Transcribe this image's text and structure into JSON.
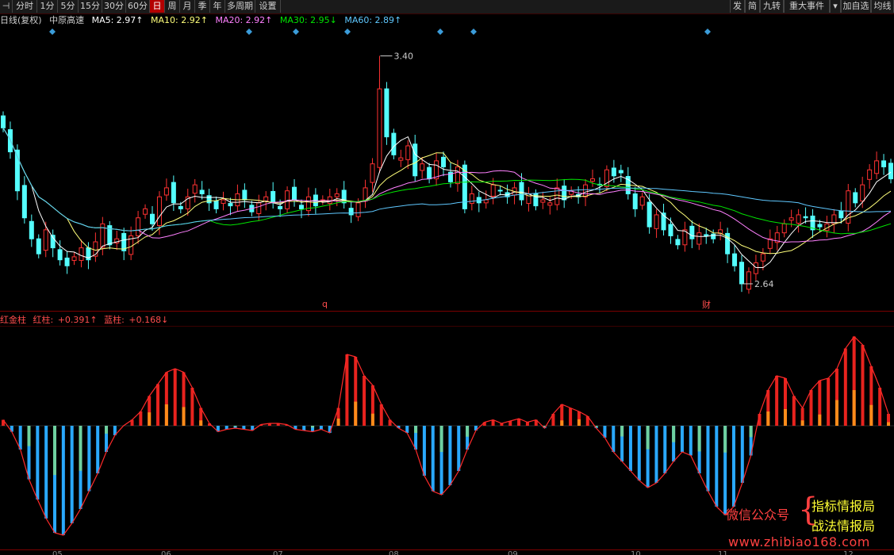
{
  "toolbar": {
    "left_items": [
      {
        "label": "⊣",
        "active": false
      },
      {
        "label": "分时",
        "active": false
      },
      {
        "label": "1分",
        "active": false
      },
      {
        "label": "5分",
        "active": false
      },
      {
        "label": "15分",
        "active": false
      },
      {
        "label": "30分",
        "active": false
      },
      {
        "label": "60分",
        "active": false
      },
      {
        "label": "日",
        "active": true
      },
      {
        "label": "周",
        "active": false
      },
      {
        "label": "月",
        "active": false
      },
      {
        "label": "季",
        "active": false
      },
      {
        "label": "年",
        "active": false
      },
      {
        "label": "多周期",
        "active": false
      },
      {
        "label": "设置",
        "active": false
      }
    ],
    "right_items": [
      {
        "label": "发"
      },
      {
        "label": "简"
      },
      {
        "label": "九转"
      },
      {
        "label": "重大事件"
      },
      {
        "label": "▾"
      },
      {
        "label": "加自选"
      },
      {
        "label": "均线"
      }
    ]
  },
  "legend_main": {
    "period": "日线(复权)",
    "name": "中原高速",
    "ma5": "MA5: 2.97↑",
    "ma10": "MA10: 2.92↑",
    "ma20": "MA20: 2.92↑",
    "ma30": "MA30: 2.95↓",
    "ma60": "MA60: 2.89↑"
  },
  "legend_indicator": {
    "name": "红金柱",
    "red_label": "红柱:",
    "red_value": "+0.391↑",
    "blue_label": "蓝柱:",
    "blue_value": "+0.168↓"
  },
  "annotations": {
    "high": "3.40",
    "low": "2.64",
    "marker_q": "q",
    "marker_cai": "财"
  },
  "watermark": {
    "wechat_label": "微信公众号",
    "brand1": "指标情报局",
    "brand2": "战法情报局",
    "url": "www.zhibiao168.com"
  },
  "axis_dates": [
    "05",
    "06",
    "07",
    "08",
    "09",
    "10",
    "11",
    "12"
  ],
  "colors": {
    "up": "#ff3232",
    "down": "#54ffff",
    "ma5": "#ffffff",
    "ma10": "#ffff7a",
    "ma20": "#ff80ff",
    "ma30": "#00e600",
    "ma60": "#5fc8ff",
    "red_bar": "#e8231e",
    "gold_bar": "#ff8c1a",
    "blue_bar": "#2aa9ff",
    "green_bar": "#6fd1a0"
  },
  "chart_data": [
    {
      "type": "candlestick",
      "title": "中原高速 日线(复权)",
      "close": [
        3.16,
        3.08,
        2.95,
        2.86,
        2.79,
        2.74,
        2.82,
        2.76,
        2.72,
        2.7,
        2.73,
        2.76,
        2.72,
        2.78,
        2.84,
        2.77,
        2.79,
        2.75,
        2.8,
        2.86,
        2.89,
        2.84,
        2.93,
        2.96,
        2.91,
        2.89,
        2.93,
        2.97,
        2.94,
        2.91,
        2.89,
        2.92,
        2.9,
        2.94,
        2.92,
        2.88,
        2.91,
        2.93,
        2.91,
        2.89,
        2.95,
        2.92,
        2.89,
        2.93,
        2.9,
        2.92,
        2.93,
        2.94,
        2.91,
        2.87,
        2.91,
        2.96,
        3.04,
        3.29,
        3.13,
        3.07,
        3.06,
        3.1,
        3.0,
        3.04,
        2.99,
        3.05,
        3.03,
        2.98,
        3.03,
        2.89,
        2.94,
        2.91,
        2.92,
        2.97,
        2.95,
        2.93,
        2.96,
        2.92,
        2.94,
        2.9,
        2.92,
        2.91,
        2.96,
        2.92,
        2.95,
        2.93,
        2.97,
        2.99,
        2.97,
        3.02,
        3.0,
        3.01,
        2.94,
        2.89,
        2.93,
        2.83,
        2.87,
        2.82,
        2.8,
        2.77,
        2.82,
        2.79,
        2.81,
        2.8,
        2.79,
        2.82,
        2.74,
        2.7,
        2.64,
        2.68,
        2.71,
        2.74,
        2.79,
        2.81,
        2.84,
        2.86,
        2.87,
        2.86,
        2.82,
        2.83,
        2.84,
        2.87,
        2.86,
        2.95,
        2.91,
        2.97,
        3.02,
        3.05,
        3.03,
        2.99
      ],
      "high_label": "3.40",
      "low_label": "2.64",
      "series": [
        {
          "name": "MA5",
          "value": 2.97
        },
        {
          "name": "MA10",
          "value": 2.92
        },
        {
          "name": "MA20",
          "value": 2.92
        },
        {
          "name": "MA30",
          "value": 2.95
        },
        {
          "name": "MA60",
          "value": 2.89
        }
      ]
    },
    {
      "type": "bar",
      "title": "红金柱",
      "values": [
        0.05,
        -0.05,
        -0.2,
        -0.45,
        -0.62,
        -0.78,
        -0.9,
        -0.92,
        -0.82,
        -0.7,
        -0.55,
        -0.4,
        -0.22,
        -0.08,
        0.0,
        0.05,
        0.12,
        0.25,
        0.35,
        0.45,
        0.48,
        0.45,
        0.32,
        0.15,
        0.02,
        -0.05,
        -0.03,
        -0.02,
        -0.03,
        -0.04,
        0.01,
        0.02,
        0.02,
        0.01,
        -0.03,
        -0.04,
        -0.05,
        -0.03,
        -0.06,
        0.15,
        0.6,
        0.58,
        0.42,
        0.34,
        0.18,
        0.05,
        -0.02,
        -0.06,
        -0.2,
        -0.42,
        -0.55,
        -0.58,
        -0.5,
        -0.38,
        -0.2,
        -0.04,
        0.03,
        0.05,
        0.02,
        0.04,
        0.06,
        0.03,
        0.05,
        -0.02,
        0.1,
        0.18,
        0.15,
        0.12,
        0.08,
        -0.02,
        -0.1,
        -0.22,
        -0.3,
        -0.38,
        -0.46,
        -0.52,
        -0.48,
        -0.4,
        -0.3,
        -0.22,
        -0.25,
        -0.4,
        -0.55,
        -0.68,
        -0.75,
        -0.68,
        -0.48,
        -0.25,
        0.1,
        0.3,
        0.42,
        0.4,
        0.25,
        0.15,
        0.3,
        0.38,
        0.4,
        0.48,
        0.65,
        0.75,
        0.68,
        0.5,
        0.32,
        0.1
      ],
      "series": [
        {
          "name": "红柱",
          "value": 0.391
        },
        {
          "name": "蓝柱",
          "value": 0.168
        }
      ]
    }
  ]
}
